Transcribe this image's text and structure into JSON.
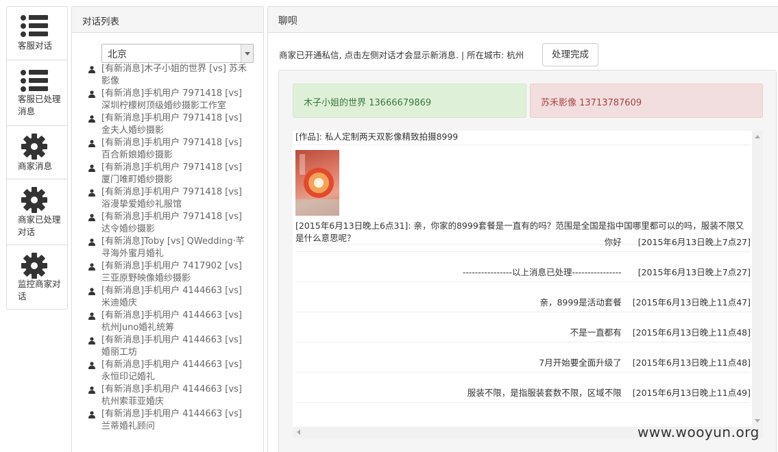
{
  "sidebar": {
    "items": [
      {
        "label": "客服对话",
        "icon": "list-icon"
      },
      {
        "label": "客服已处理消息",
        "icon": "list-icon"
      },
      {
        "label": "商家消息",
        "icon": "gear-icon"
      },
      {
        "label": "商家已处理对话",
        "icon": "gear-icon"
      },
      {
        "label": "监控商家对话",
        "icon": "gear-icon"
      }
    ]
  },
  "list_panel": {
    "title": "对话列表",
    "city_select": "北京",
    "conversations": [
      {
        "line1": "[有新消息]木子小姐的世界 [vs] 苏禾",
        "line2": "影像"
      },
      {
        "line1": "[有新消息]手机用户 7971418 [vs]",
        "line2": "深圳柠檬树顶级婚纱摄影工作室"
      },
      {
        "line1": "[有新消息]手机用户 7971418 [vs]",
        "line2": "金夫人婚纱摄影"
      },
      {
        "line1": "[有新消息]手机用户 7971418 [vs]",
        "line2": "百合新娘婚纱摄影"
      },
      {
        "line1": "[有新消息]手机用户 7971418 [vs]",
        "line2": "厦门唯町婚纱摄影"
      },
      {
        "line1": "[有新消息]手机用户 7971418 [vs]",
        "line2": "浴漫挚爱婚纱礼服馆"
      },
      {
        "line1": "[有新消息]手机用户 7971418 [vs]",
        "line2": "达令婚纱摄影"
      },
      {
        "line1": "[有新消息]Toby [vs] QWedding·芊",
        "line2": "寻海外蜜月婚礼"
      },
      {
        "line1": "[有新消息]手机用户 7417902 [vs]",
        "line2": "三亚原野映像婚纱摄影"
      },
      {
        "line1": "[有新消息]手机用户 4144663 [vs]",
        "line2": "米迪婚庆"
      },
      {
        "line1": "[有新消息]手机用户 4144663 [vs]",
        "line2": "杭州Juno婚礼统筹"
      },
      {
        "line1": "[有新消息]手机用户 4144663 [vs]",
        "line2": "婚丽工坊"
      },
      {
        "line1": "[有新消息]手机用户 4144663 [vs]",
        "line2": "永恒印记婚礼"
      },
      {
        "line1": "[有新消息]手机用户 4144663 [vs]",
        "line2": "杭州索菲亚婚庆"
      },
      {
        "line1": "[有新消息]手机用户 4144663 [vs]",
        "line2": "兰蒂婚礼顾问"
      }
    ]
  },
  "chat": {
    "title": "聊呗",
    "notice": "商家已开通私信, 点击左侧对话才会显示新消息. | 所在城市: 杭州",
    "done_button": "处理完成",
    "party_left": "木子小姐的世界 13666679869",
    "party_right": "苏禾影像 13713787609",
    "product_line": "[作品]: 私人定制两天双影像精致拍摄8999",
    "question": "[2015年6月13日晚上6点31]: 亲，你家的8999套餐是一直有的吗？范围是全国是指中国哪里都可以的吗，服装不限又是什么意思呢？",
    "replies": [
      {
        "text": "你好",
        "time": "[2015年6月13日晚上7点27]"
      },
      {
        "text": "----------------以上消息已处理----------------",
        "time": "[2015年6月13日晚上7点27]"
      },
      {
        "text": "亲，8999是活动套餐",
        "time": "[2015年6月13日晚上11点47]"
      },
      {
        "text": "不是一直都有",
        "time": "[2015年6月13日晚上11点48]"
      },
      {
        "text": "7月开始要全面升级了",
        "time": "[2015年6月13日晚上11点48]"
      },
      {
        "text": "服装不限，是指服装套数不限，区域不限",
        "time": "[2015年6月13日晚上11点49]"
      }
    ]
  },
  "watermark": "www.wooyun.org"
}
